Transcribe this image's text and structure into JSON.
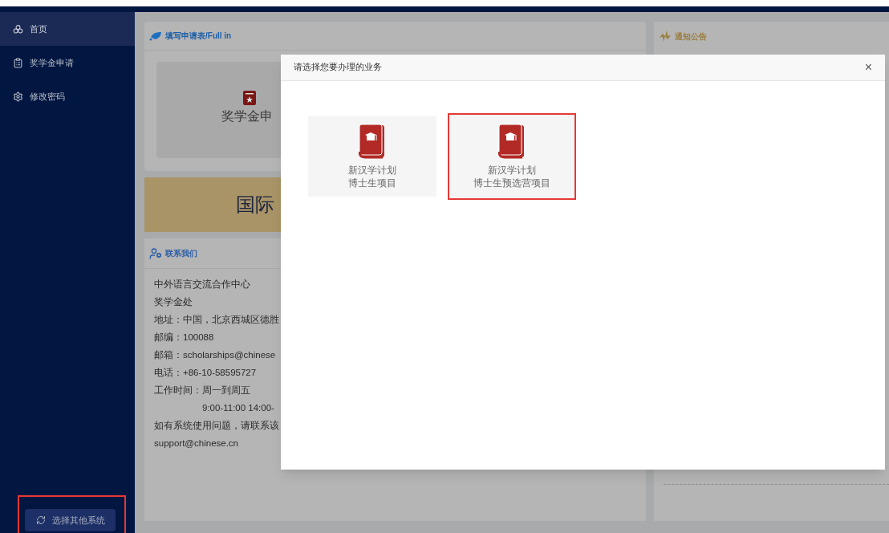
{
  "sidebar": {
    "items": [
      {
        "label": "首页",
        "selected": true
      },
      {
        "label": "奖学金申请",
        "selected": false
      },
      {
        "label": "修改密码",
        "selected": false
      }
    ],
    "switch_button": {
      "label": "选择其他系统",
      "highlighted": true
    }
  },
  "apply_card": {
    "title": "填写申请表/Full in",
    "tile_label": "奖学金申"
  },
  "banner": {
    "text": "国际"
  },
  "contact_card": {
    "title": "联系我们",
    "lines": [
      {
        "text": "中外语言交流合作中心",
        "indented": false
      },
      {
        "text": "奖学金处",
        "indented": false
      },
      {
        "text": "地址：中国，北京西城区德胜",
        "indented": false
      },
      {
        "text": "邮编：100088",
        "indented": false
      },
      {
        "text": "邮箱：scholarships@chinese",
        "indented": false
      },
      {
        "text": "电话：+86-10-58595727",
        "indented": false
      },
      {
        "text": "工作时间：周一到周五",
        "indented": false
      },
      {
        "text": "9:00-11:00 14:00-",
        "indented": true
      },
      {
        "text": "如有系统使用问题，请联系该",
        "indented": false
      },
      {
        "text": "support@chinese.cn",
        "indented": false
      }
    ]
  },
  "notice_card": {
    "title": "通知公告"
  },
  "dialog": {
    "title": "请选择您要办理的业务",
    "close": "×",
    "options": [
      {
        "line1": "新汉学计划",
        "line2": "博士生项目",
        "selected": false
      },
      {
        "line1": "新汉学计划",
        "line2": "博士生预选营项目",
        "selected": true
      }
    ]
  }
}
